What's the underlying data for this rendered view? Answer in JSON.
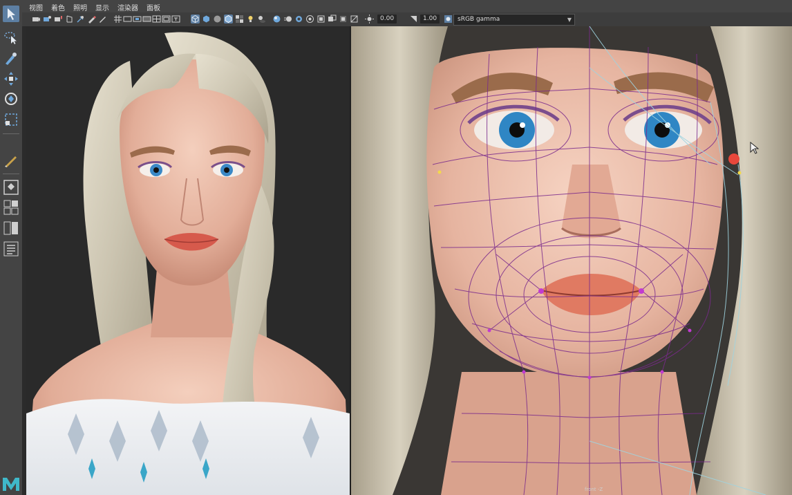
{
  "menus": [
    "视图",
    "着色",
    "照明",
    "显示",
    "渲染器",
    "面板"
  ],
  "toolbar": {
    "exposure_value": "0.00",
    "gamma_value": "1.00",
    "color_space": "sRGB gamma"
  },
  "viewport_right": {
    "camera_label": "front -Z"
  },
  "colors": {
    "ui_panel": "#444444",
    "highlight": "#5d7fa3",
    "wire_purple": "#7a2a8c",
    "wire_cyan": "#9fd4e0"
  }
}
